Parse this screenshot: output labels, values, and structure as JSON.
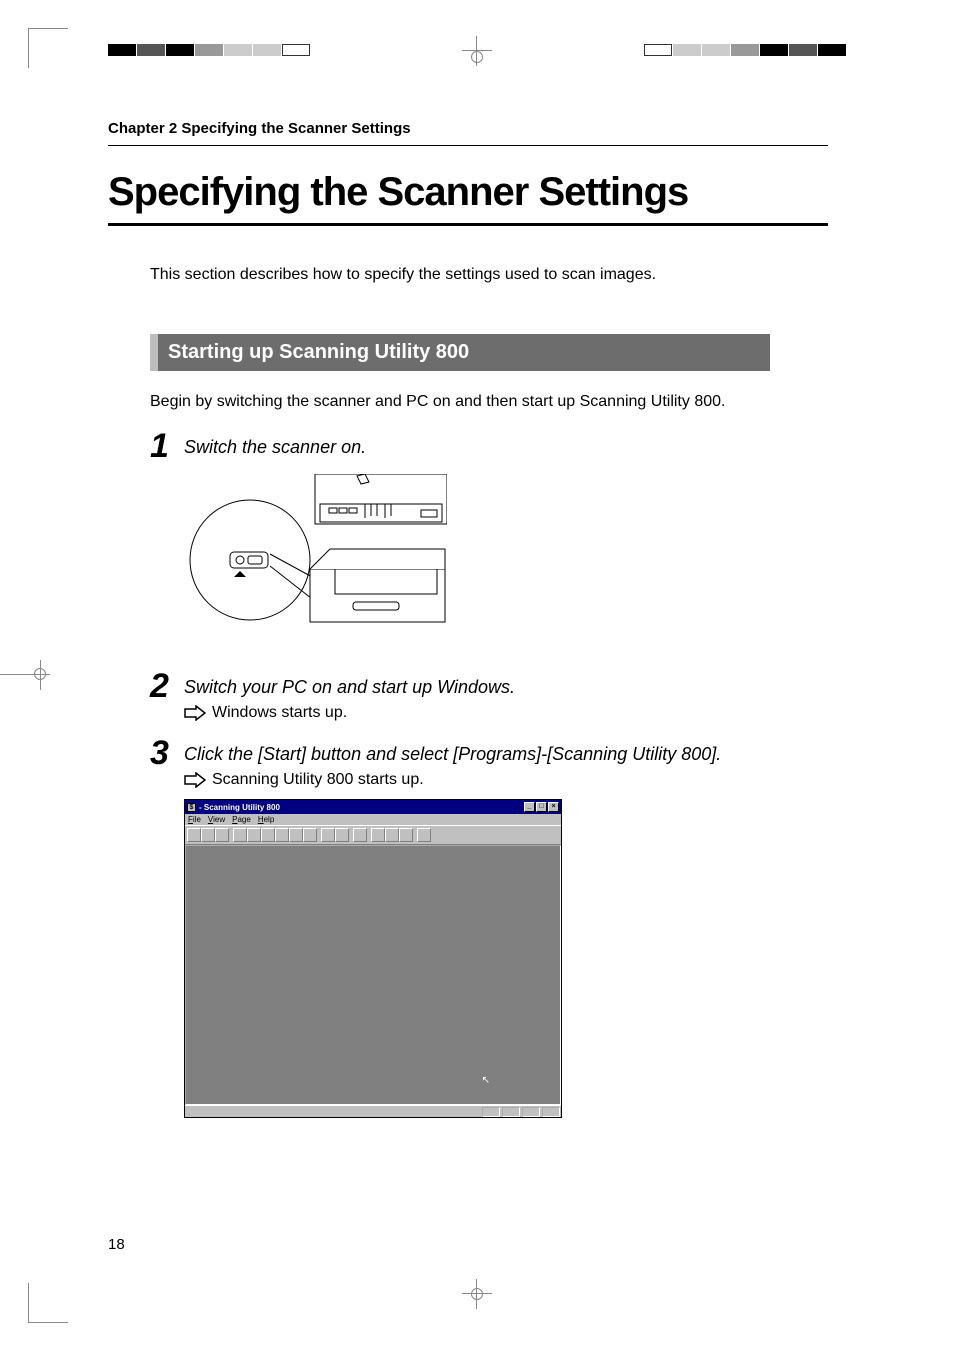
{
  "page": {
    "chapter_header": "Chapter 2 Specifying the Scanner Settings",
    "title": "Specifying the Scanner Settings",
    "intro": "This section describes how to specify the settings used to scan images.",
    "section_heading": "Starting up Scanning Utility 800",
    "section_intro": "Begin by switching the scanner and PC on and then start up Scanning Utility 800.",
    "page_number": "18"
  },
  "steps": [
    {
      "num": "1",
      "title": "Switch the scanner on.",
      "result": ""
    },
    {
      "num": "2",
      "title": "Switch your PC on and start up Windows.",
      "result": "Windows starts up."
    },
    {
      "num": "3",
      "title": "Click the [Start] button and select [Programs]-[Scanning Utility 800].",
      "result": "Scanning Utility 800 starts up."
    }
  ],
  "app_window": {
    "title": "- Scanning Utility 800",
    "menus": [
      "File",
      "View",
      "Page",
      "Help"
    ],
    "window_controls": {
      "min": "_",
      "max": "□",
      "close": "×"
    },
    "sys_icon": "$"
  }
}
